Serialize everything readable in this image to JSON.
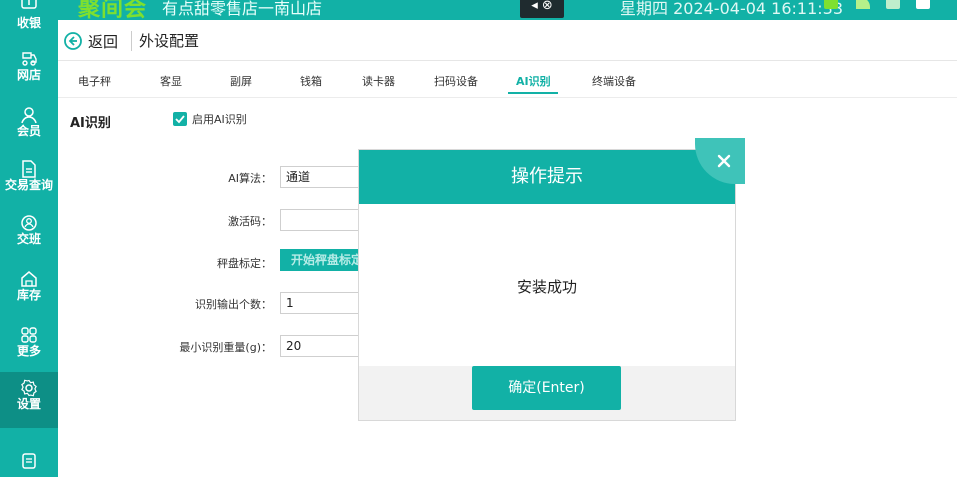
{
  "topbar": {
    "brand": "聚间会",
    "store": "有点甜零售店一南山店",
    "window_control": "◂ ⊗",
    "datetime": "星期四 2024-04-04 16:11:33"
  },
  "sidebar": {
    "items": [
      {
        "label": "收银",
        "icon": "cashier-icon"
      },
      {
        "label": "网店",
        "icon": "online-store-icon"
      },
      {
        "label": "会员",
        "icon": "member-icon"
      },
      {
        "label": "交易查询",
        "icon": "transaction-query-icon"
      },
      {
        "label": "交班",
        "icon": "shift-handover-icon"
      },
      {
        "label": "库存",
        "icon": "inventory-icon"
      },
      {
        "label": "更多",
        "icon": "more-icon"
      },
      {
        "label": "设置",
        "icon": "settings-icon",
        "active": true
      },
      {
        "label": "",
        "icon": "receipt-icon"
      }
    ]
  },
  "header": {
    "back_label": "返回",
    "page_title": "外设配置"
  },
  "tabs": {
    "items": [
      "电子秤",
      "客显",
      "副屏",
      "钱箱",
      "读卡器",
      "扫码设备",
      "AI识别",
      "终端设备"
    ],
    "active": "AI识别"
  },
  "ai": {
    "section_title": "AI识别",
    "enable_label": "启用AI识别",
    "enabled": true,
    "algorithm_label": "AI算法：",
    "algorithm_value": "通道",
    "activation_label": "激活码：",
    "activation_value": "",
    "calibration_label": "秤盘标定：",
    "calibration_button": "开始秤盘标定",
    "output_count_label": "识别输出个数：",
    "output_count_value": "1",
    "min_weight_label": "最小识别重量(g)：",
    "min_weight_value": "20"
  },
  "modal": {
    "title": "操作提示",
    "message": "安装成功",
    "ok_label": "确定(Enter)"
  },
  "colors": {
    "accent": "#12b1a6",
    "accent_dark": "#0d8f86",
    "brand_green": "#7ee02f"
  }
}
